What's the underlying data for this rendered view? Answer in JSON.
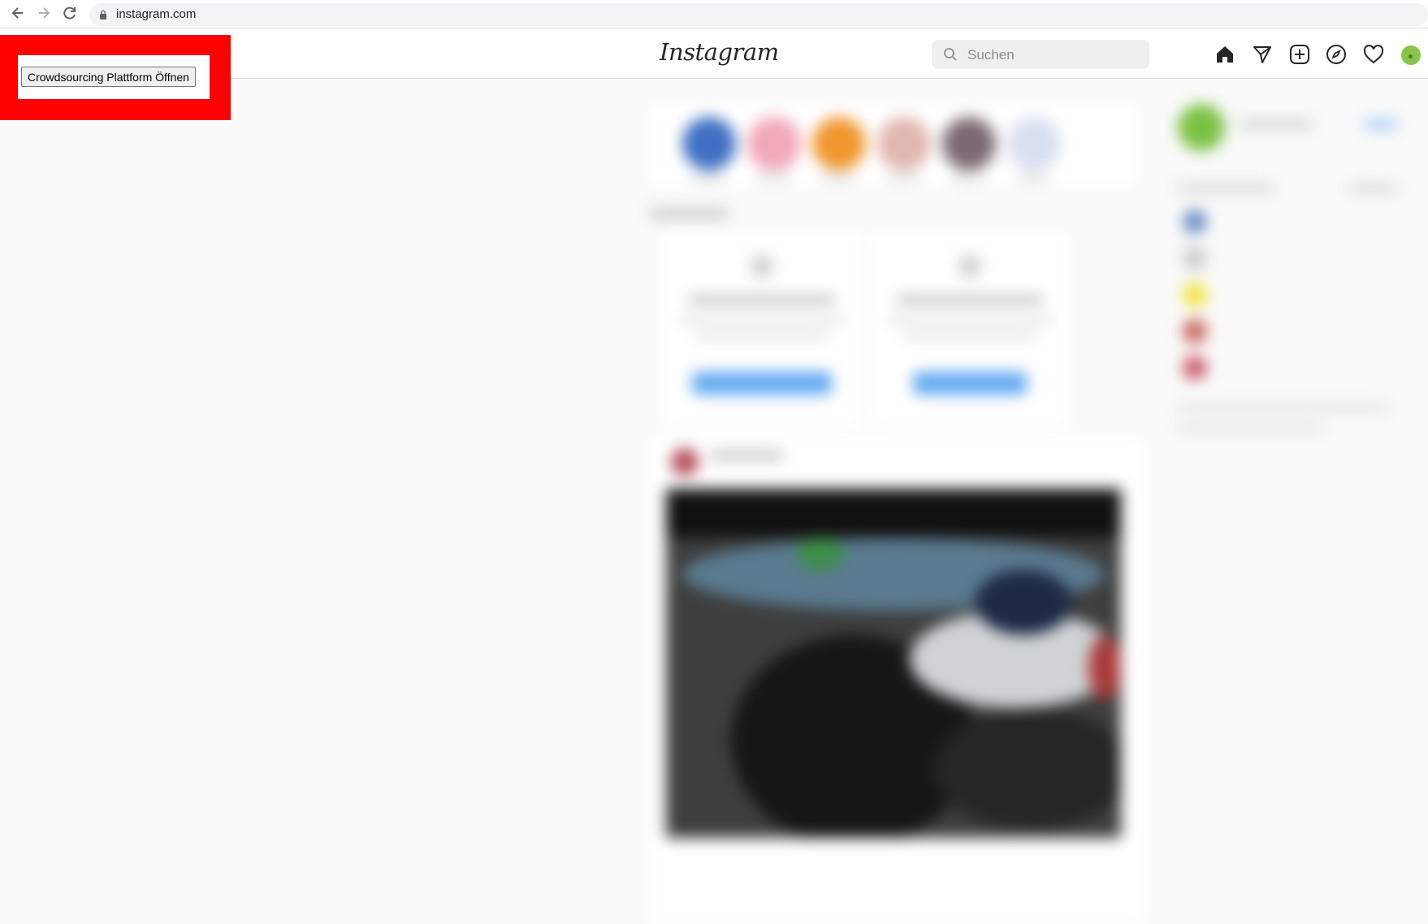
{
  "browser": {
    "url": "instagram.com"
  },
  "instagram": {
    "logo": "Instagram",
    "search_placeholder": "Suchen",
    "nav_icons": [
      "home-icon",
      "direct-message-icon",
      "new-post-icon",
      "explore-icon",
      "activity-heart-icon",
      "profile-avatar"
    ]
  },
  "overlay": {
    "button_label": "Crowdsourcing Plattform Öffnen",
    "panel_color": "#ff0000"
  },
  "colors": {
    "accent_blue": "#0095f6",
    "background": "#fafafa"
  }
}
